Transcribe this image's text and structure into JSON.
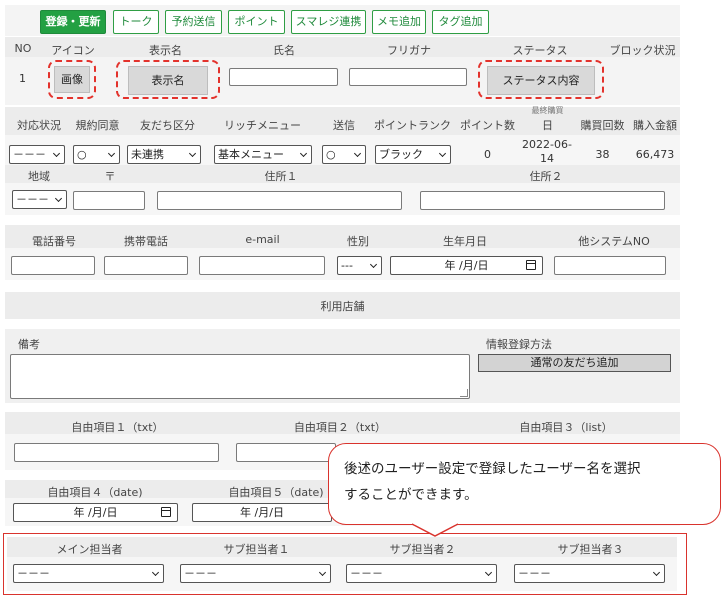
{
  "toolbar": {
    "register_update": "登録・更新",
    "talk": "トーク",
    "scheduled_send": "予約送信",
    "points": "ポイント",
    "smaregi": "スマレジ連携",
    "memo_add": "メモ追加",
    "tag_add": "タグ追加"
  },
  "header": {
    "no": "NO",
    "icon": "アイコン",
    "display_name": "表示名",
    "name": "氏名",
    "furigana": "フリガナ",
    "status": "ステータス",
    "block": "ブロック状況"
  },
  "row1": {
    "no": "1",
    "icon_placeholder": "画像",
    "display_name_placeholder": "表示名",
    "status_placeholder": "ステータス内容"
  },
  "header2": {
    "response": "対応状況",
    "terms": "規約同意",
    "friend_type": "友だち区分",
    "rich_menu": "リッチメニュー",
    "send": "送信",
    "point_rank": "ポイントランク",
    "point_count": "ポイント数",
    "last_purchase_small": "最終購買",
    "last_purchase": "日",
    "purchase_count": "購買回数",
    "purchase_amount": "購入金額"
  },
  "row2": {
    "response": "－－－",
    "terms": "○",
    "friend_type": "未連携",
    "rich_menu": "基本メニュー",
    "send": "○",
    "point_rank": "ブラック",
    "point_count": "0",
    "last_purchase": "2022-06-14",
    "purchase_count": "38",
    "purchase_amount": "66,473"
  },
  "address": {
    "region": "地域",
    "postal": "〒",
    "address1": "住所１",
    "address2": "住所２",
    "region_value": "－－－"
  },
  "contact": {
    "phone": "電話番号",
    "mobile": "携帯電話",
    "email": "e-mail",
    "gender": "性別",
    "birthday": "生年月日",
    "other_system": "他システムNO",
    "gender_value": "---",
    "birthday_value": "年 /月/日"
  },
  "store": {
    "label": "利用店舗"
  },
  "notes": {
    "label": "備考",
    "registration_method": "情報登録方法",
    "registration_value": "通常の友だち追加"
  },
  "free": {
    "f1": "自由項目１（txt）",
    "f2": "自由項目２（txt）",
    "f3": "自由項目３（list）",
    "f4": "自由項目４（date)",
    "f5": "自由項目５（date)",
    "date_value": "年 /月/日"
  },
  "staff": {
    "main": "メイン担当者",
    "sub1": "サブ担当者１",
    "sub2": "サブ担当者２",
    "sub3": "サブ担当者３",
    "value": "－－－"
  },
  "callout": {
    "line1": "後述のユーザー設定で登録したユーザー名を選択",
    "line2": "することができます。"
  },
  "colors": {
    "accent": "#23a043",
    "annotation": "#e3322c",
    "panel": "#ececec"
  }
}
